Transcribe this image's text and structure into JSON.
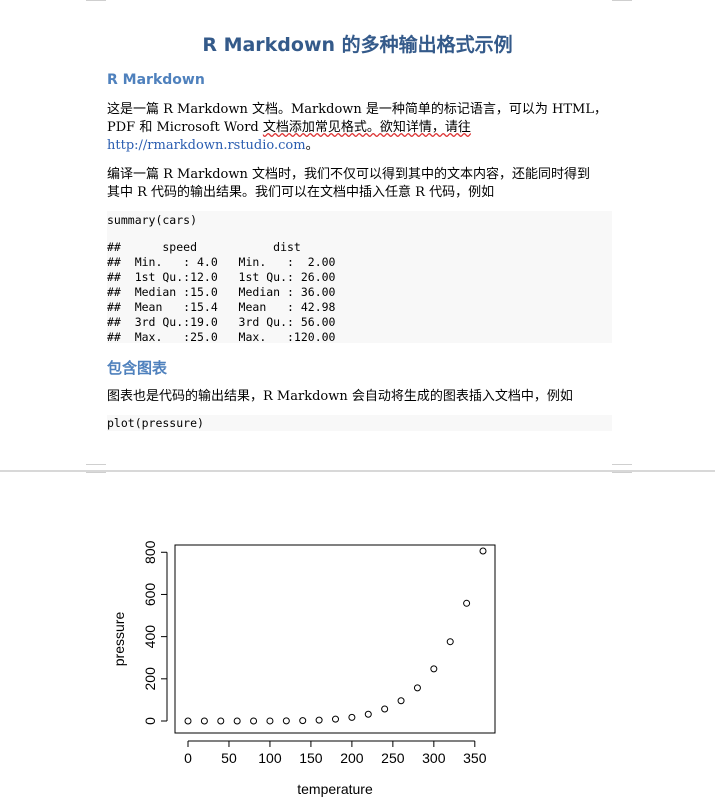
{
  "document": {
    "title": "R Markdown 的多种输出格式示例",
    "section1": {
      "heading": "R Markdown",
      "para1": {
        "line1": "这是一篇 R Markdown 文档。Markdown 是一种简单的标记语言，可以为 HTML，",
        "line2_plain": "PDF 和 Microsoft Word ",
        "line2_wavy": "文档添加常见格式。欲知详情，请往",
        "link": "http://rmarkdown.rstudio.com",
        "link_tail": "。"
      },
      "para2": {
        "line1": "编译一篇 R Markdown 文档时，我们不仅可以得到其中的文本内容，还能同时得到",
        "line2": "其中 R 代码的输出结果。我们可以在文档中插入任意 R 代码，例如"
      },
      "code1": "summary(cars)",
      "output1": [
        "##      speed           dist       ",
        "##  Min.   : 4.0   Min.   :  2.00  ",
        "##  1st Qu.:12.0   1st Qu.: 26.00  ",
        "##  Median :15.0   Median : 36.00  ",
        "##  Mean   :15.4   Mean   : 42.98  ",
        "##  3rd Qu.:19.0   3rd Qu.: 56.00  ",
        "##  Max.   :25.0   Max.   :120.00  "
      ]
    },
    "section2": {
      "heading": "包含图表",
      "para": "图表也是代码的输出结果，R Markdown 会自动将生成的图表插入文档中，例如",
      "code": "plot(pressure)"
    }
  },
  "chart_data": {
    "type": "scatter",
    "xlabel": "temperature",
    "ylabel": "pressure",
    "xticks": [
      0,
      50,
      100,
      150,
      200,
      250,
      300,
      350
    ],
    "yticks": [
      0,
      200,
      400,
      600,
      800
    ],
    "xlim": [
      0,
      360
    ],
    "ylim": [
      0,
      806
    ],
    "x": [
      0,
      20,
      40,
      60,
      80,
      100,
      120,
      140,
      160,
      180,
      200,
      220,
      240,
      260,
      280,
      300,
      320,
      340,
      360
    ],
    "y": [
      0.0002,
      0.0012,
      0.006,
      0.03,
      0.09,
      0.27,
      0.75,
      1.85,
      4.2,
      8.8,
      17.3,
      32.1,
      57,
      96,
      157,
      247,
      376,
      558,
      806
    ]
  }
}
